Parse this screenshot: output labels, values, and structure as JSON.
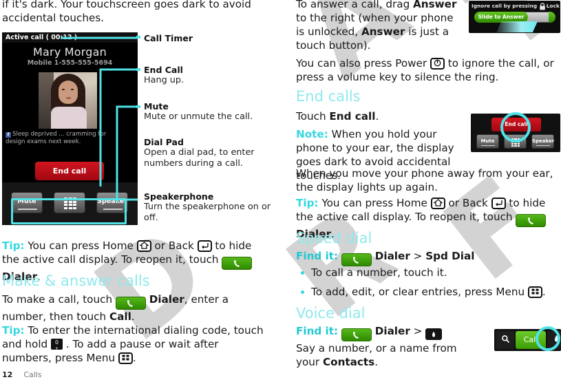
{
  "watermark": {
    "text": "DRAFT",
    "color": "#d0d0d0"
  },
  "colors": {
    "accent_cyan": "#35d8e0",
    "heading_cyan": "#8fe9ec",
    "highlight_cyan": "#4fe3e8",
    "dialer_green": "#3d9e06",
    "end_call_red": "#d31520"
  },
  "left_column": {
    "lead_paragraph": "if it's dark. Your touchscreen goes dark to avoid accidental touches.",
    "screenshot": {
      "status_bar": "Active call ( 00:12 )",
      "contact_name": "Mary Morgan",
      "contact_number": "Mobile 1-555-555-5694",
      "social_status": "Sleep deprived ... cramming for design exams next week.",
      "social_icon": "facebook-icon",
      "end_call_label": "End call",
      "buttons": [
        {
          "name": "mute-button",
          "label": "Mute"
        },
        {
          "name": "dialpad-button",
          "label": ""
        },
        {
          "name": "speaker-button",
          "label": "Speaker"
        }
      ]
    },
    "callouts": [
      {
        "title": "Call Timer",
        "desc": ""
      },
      {
        "title": "End Call",
        "desc": "Hang up."
      },
      {
        "title": "Mute",
        "desc": "Mute or unmute the call."
      },
      {
        "title": "Dial Pad",
        "desc": "Open a dial pad, to enter numbers during a call."
      },
      {
        "title": "Speakerphone",
        "desc": "Turn the speakerphone on or off."
      }
    ],
    "tip1": {
      "label": "Tip:",
      "part1": "You can press Home",
      "part2": "or Back",
      "part3": "to hide the active call display. To reopen it, touch",
      "dialer": "Dialer",
      "part4": "."
    },
    "section_make_answer": "Make & answer calls",
    "make_call": {
      "part1": "To make a call, touch",
      "dialer": "Dialer",
      "part2": ", enter a number, then touch",
      "bold": "Call",
      "part3": "."
    },
    "tip2": {
      "label": "Tip:",
      "part1": "To enter the international dialing code, touch and hold",
      "part2": ". To add a pause or wait after numbers, press Menu",
      "part3": "."
    }
  },
  "right_column": {
    "answer_paragraph": {
      "part1": "To answer a call, drag",
      "bold1": "Answer",
      "part2": "to the right (when your phone is unlocked,",
      "bold2": "Answer",
      "part3": "is just a touch button)."
    },
    "power_paragraph": {
      "part1": "You can also press Power",
      "part2": "to ignore the call, or press a volume key to silence the ring."
    },
    "lock_screenshot": {
      "top_text_before": "Ignore call by pressing",
      "lock_icon": "lock-icon",
      "top_text_after": "Lock button",
      "slider_label": "Slide to Answer"
    },
    "section_end_calls": "End calls",
    "touch_end_call": {
      "part1": "Touch",
      "bold": "End call",
      "part2": "."
    },
    "note": {
      "label": "Note:",
      "text": "When you hold your phone to your ear, the display goes dark to avoid accidental touches."
    },
    "note_cont": "When you move your phone away from your ear, the display lights up again.",
    "end_tray_screenshot": {
      "end_call_label": "End call",
      "buttons": [
        {
          "name": "mute-button",
          "label": "Mute"
        },
        {
          "name": "dialpad-button",
          "label": ""
        },
        {
          "name": "speaker-button",
          "label": "Speaker"
        }
      ]
    },
    "tip3": {
      "label": "Tip:",
      "part1": "You can press Home",
      "part2": "or Back",
      "part3": "to hide the active call display. To reopen it, touch",
      "dialer": "Dialer",
      "part4": "."
    },
    "section_speed_dial": "Speed dial",
    "speed_dial_find": {
      "label": "Find it:",
      "dialer": "Dialer",
      "sep": ">",
      "target": "Spd Dial"
    },
    "speed_dial_bullets": [
      {
        "part1": "To call a number, touch it.",
        "has_icon": false
      },
      {
        "part1": "To add, edit, or clear entries, press Menu",
        "part2": ".",
        "has_icon": true
      }
    ],
    "section_voice_dial": "Voice dial",
    "voice_dial_find": {
      "label": "Find it:",
      "dialer": "Dialer",
      "sep": ">",
      "icon": "microphone-icon"
    },
    "voice_dial_body": {
      "part1": "Say a number, or a name from your",
      "bold": "Contacts",
      "part2": "."
    },
    "dial_bar_screenshot": {
      "search_icon": "search-icon",
      "call_label": "Call",
      "mic_icon": "microphone-icon"
    }
  },
  "footer": {
    "page_number": "12",
    "chapter": "Calls"
  }
}
